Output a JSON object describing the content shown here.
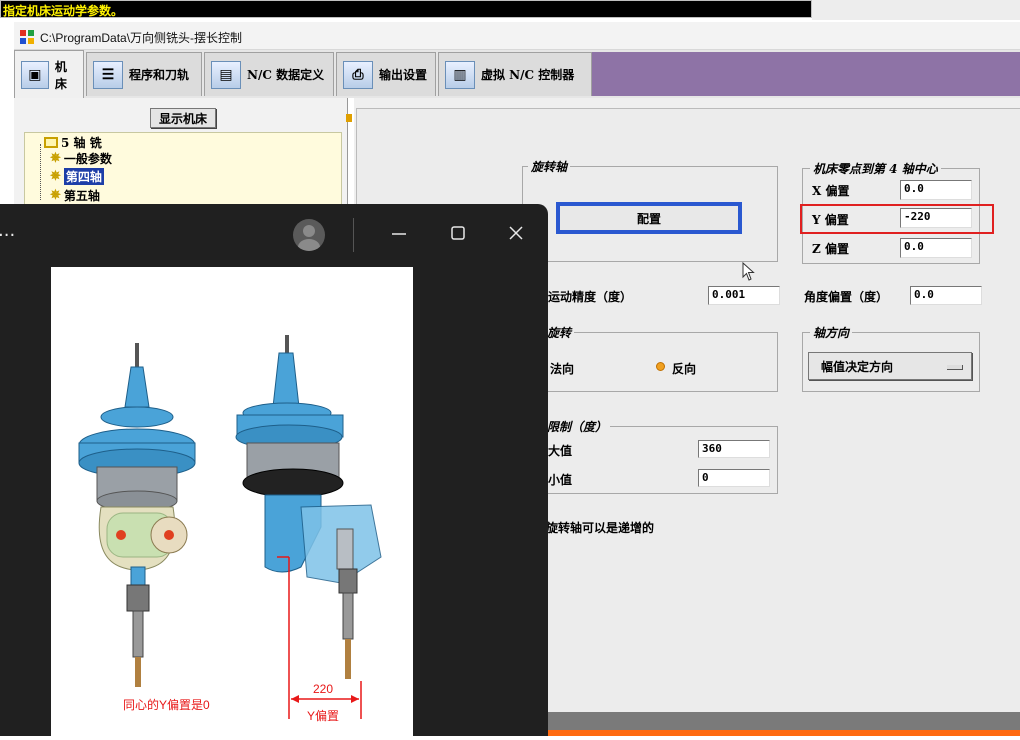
{
  "window": {
    "title": "指定机床运动学参数。",
    "path": "C:\\ProgramData\\万向侧铣头-摆长控制"
  },
  "tabs": [
    {
      "label": "机床",
      "icon": "machine-icon",
      "active": true
    },
    {
      "label": "程序和刀轨",
      "icon": "program-icon",
      "active": false
    },
    {
      "label": "N/C 数据定义",
      "icon": "nc-data-icon",
      "active": false
    },
    {
      "label": "输出设置",
      "icon": "printer-icon",
      "active": false
    },
    {
      "label": "虚拟 N/C 控制器",
      "icon": "controller-icon",
      "active": false
    }
  ],
  "left": {
    "show_machine_button": "显示机床",
    "tree": {
      "root": "5 轴 铣",
      "items": [
        {
          "label": "一般参数",
          "selected": false
        },
        {
          "label": "第四轴",
          "selected": true
        },
        {
          "label": "第五轴",
          "selected": false
        }
      ]
    }
  },
  "rotary_axis": {
    "group_label": "旋转轴",
    "config_button": "配置"
  },
  "zero_to_center": {
    "group_label": "机床零点到第 4 轴中心",
    "x_label": "X 偏置",
    "x_value": "0.0",
    "y_label": "Y 偏置",
    "y_value": "-220",
    "z_label": "Z 偏置",
    "z_value": "0.0"
  },
  "motion_precision": {
    "label": "运动精度（度）",
    "value": "0.001"
  },
  "angle_offset": {
    "label": "角度偏置（度）",
    "value": "0.0"
  },
  "rotation": {
    "group_label": "旋转",
    "normal": "法向",
    "reverse": "反向",
    "selected": "reverse"
  },
  "axis_direction": {
    "group_label": "轴方向",
    "value": "幅值决定方向"
  },
  "limits": {
    "group_label": "限制（度）",
    "max_label": "大值",
    "max_value": "360",
    "min_label": "小值",
    "min_value": "0"
  },
  "incremental_note": "旋转轴可以是递增的",
  "viewer": {
    "menu": "...",
    "annotation_left": "同心的Y偏置是0",
    "dimension_value": "220",
    "dimension_label": "Y偏置"
  },
  "colors": {
    "title_bg": "#000000",
    "title_text": "#fff200",
    "tab_accent": "#8e73a6",
    "config_border": "#2a58d0",
    "highlight_red": "#e02020",
    "head_blue": "#4aa3d8"
  }
}
